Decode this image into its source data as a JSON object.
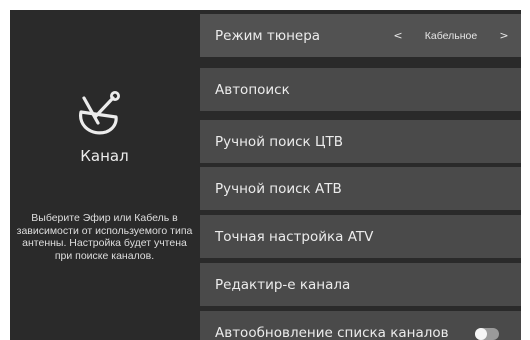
{
  "side_panel": {
    "icon": "satellite-dish-icon",
    "title": "Канал",
    "hint": "Выберите Эфир или Кабель в зависимости от используемого типа антенны. Настройка будет учтена при поиске каналов."
  },
  "menu": {
    "tuner_mode": {
      "label": "Режим тюнера",
      "value": "Кабельное",
      "prev_arrow": "<",
      "next_arrow": ">"
    },
    "auto_search": {
      "label": "Автопоиск"
    },
    "manual_search_dtv": {
      "label": "Ручной поиск ЦТВ"
    },
    "manual_search_atv": {
      "label": "Ручной поиск АТВ"
    },
    "fine_tune_atv": {
      "label": "Точная настройка ATV"
    },
    "channel_edit": {
      "label": "Редактир-е канала"
    },
    "auto_update_channels": {
      "label": "Автообновление списка каналов",
      "enabled": false
    }
  },
  "colors": {
    "screen_background": "#2a2a2a",
    "item_background": "#4a4a4a",
    "text": "#ececec"
  }
}
